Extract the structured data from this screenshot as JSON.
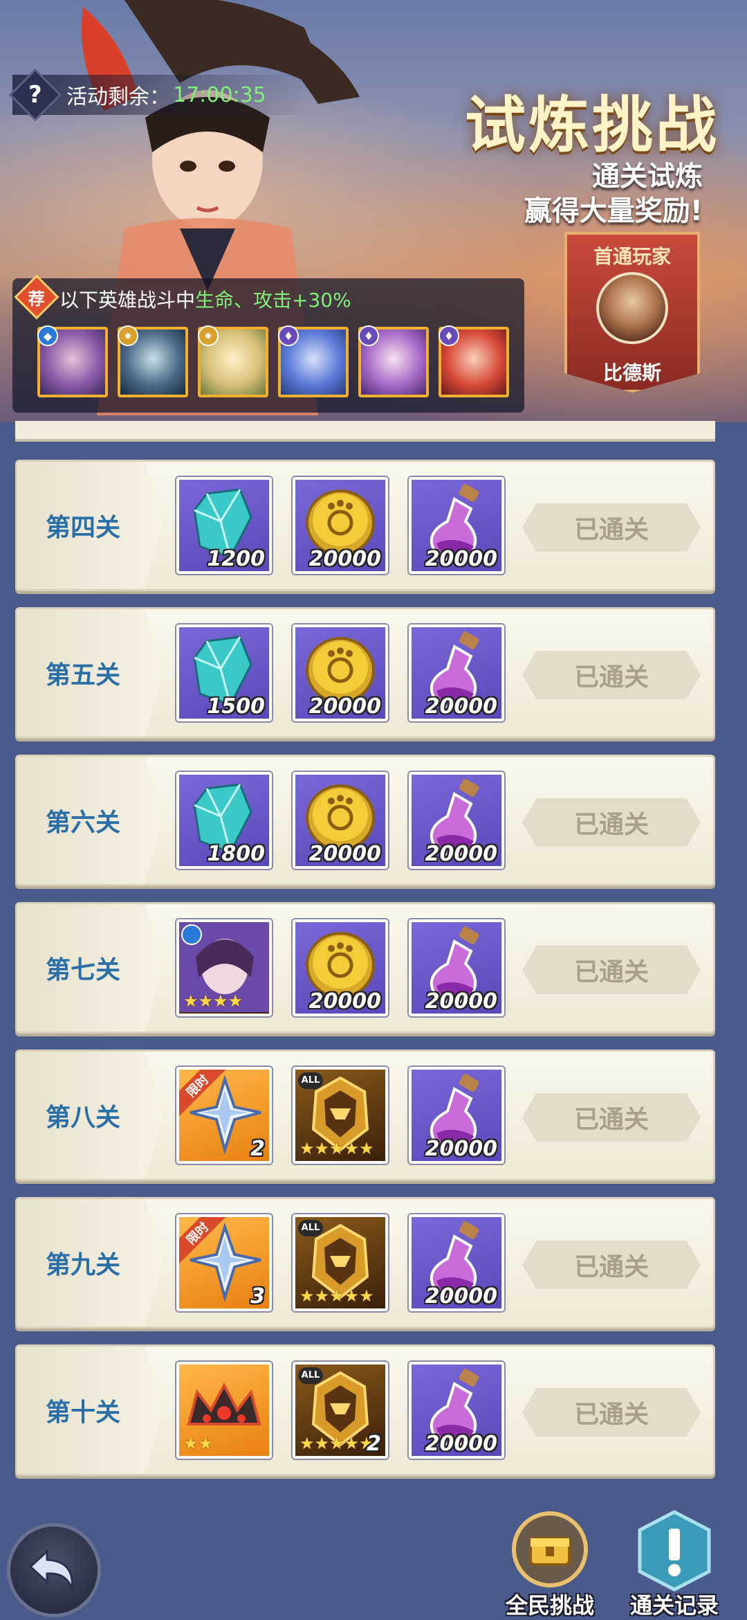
{
  "header": {
    "timer_label": "活动剩余：",
    "timer_value": "17:00:35",
    "title": "试炼挑战",
    "subtitle_line1": "通关试炼",
    "subtitle_line2": "赢得大量奖励!",
    "first_clear": {
      "label": "首通玩家",
      "player_name": "比德斯"
    },
    "bonus": {
      "tag": "荐",
      "text_prefix": "以下英雄战斗中",
      "text_highlight": "生命、攻击+30%"
    }
  },
  "stages": [
    {
      "label": "第四关",
      "status": "已通关",
      "rewards": [
        {
          "icon": "crystal-icon",
          "qty": "1200"
        },
        {
          "icon": "gold-coin-icon",
          "qty": "20000"
        },
        {
          "icon": "potion-icon",
          "qty": "20000"
        }
      ]
    },
    {
      "label": "第五关",
      "status": "已通关",
      "rewards": [
        {
          "icon": "crystal-icon",
          "qty": "1500"
        },
        {
          "icon": "gold-coin-icon",
          "qty": "20000"
        },
        {
          "icon": "potion-icon",
          "qty": "20000"
        }
      ]
    },
    {
      "label": "第六关",
      "status": "已通关",
      "rewards": [
        {
          "icon": "crystal-icon",
          "qty": "1800"
        },
        {
          "icon": "gold-coin-icon",
          "qty": "20000"
        },
        {
          "icon": "potion-icon",
          "qty": "20000"
        }
      ]
    },
    {
      "label": "第七关",
      "status": "已通关",
      "rewards": [
        {
          "icon": "hero-portrait-icon",
          "stars": "★★★★"
        },
        {
          "icon": "gold-coin-icon",
          "qty": "20000"
        },
        {
          "icon": "potion-icon",
          "qty": "20000"
        }
      ]
    },
    {
      "label": "第八关",
      "status": "已通关",
      "rewards": [
        {
          "icon": "limited-shard-icon",
          "qty": "2",
          "tag": "限时"
        },
        {
          "icon": "all-hero-chest-icon",
          "stars": "★★★★★",
          "tag": "ALL"
        },
        {
          "icon": "potion-icon",
          "qty": "20000"
        }
      ]
    },
    {
      "label": "第九关",
      "status": "已通关",
      "rewards": [
        {
          "icon": "limited-shard-icon",
          "qty": "3",
          "tag": "限时"
        },
        {
          "icon": "all-hero-chest-icon",
          "stars": "★★★★★",
          "tag": "ALL"
        },
        {
          "icon": "potion-icon",
          "qty": "20000"
        }
      ]
    },
    {
      "label": "第十关",
      "status": "已通关",
      "rewards": [
        {
          "icon": "crown-icon",
          "stars": "★★"
        },
        {
          "icon": "all-hero-chest-icon",
          "stars": "★★★★★",
          "qty": "2",
          "tag": "ALL"
        },
        {
          "icon": "potion-icon",
          "qty": "20000"
        }
      ]
    }
  ],
  "footer": {
    "challenge_label": "全民挑战",
    "record_label": "通关记录"
  },
  "colors": {
    "accent_green": "#7ff07a",
    "stage_label": "#2a6ea8",
    "cleared_text": "#a89f8c"
  }
}
